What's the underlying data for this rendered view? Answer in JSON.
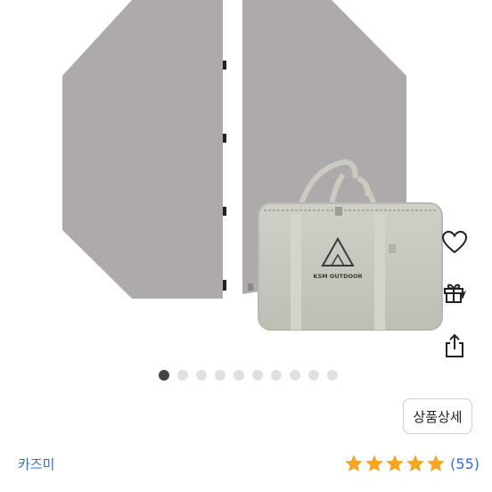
{
  "product": {
    "bag_logo_text": "KSM OUTDOOR",
    "carousel": {
      "total": 10,
      "current": 1
    }
  },
  "actions": {
    "wishlist_icon": "heart-outline-icon",
    "gift_icon": "gift-icon",
    "share_icon": "share-icon"
  },
  "detail_button_label": "상품상세",
  "seller": {
    "name": "카즈미"
  },
  "rating": {
    "stars": 5,
    "count_label": "(55)"
  },
  "colors": {
    "accent_blue": "#2f6fd1",
    "star": "#f5a623",
    "dot_active": "#444444",
    "dot_inactive": "#e0e0e0"
  }
}
